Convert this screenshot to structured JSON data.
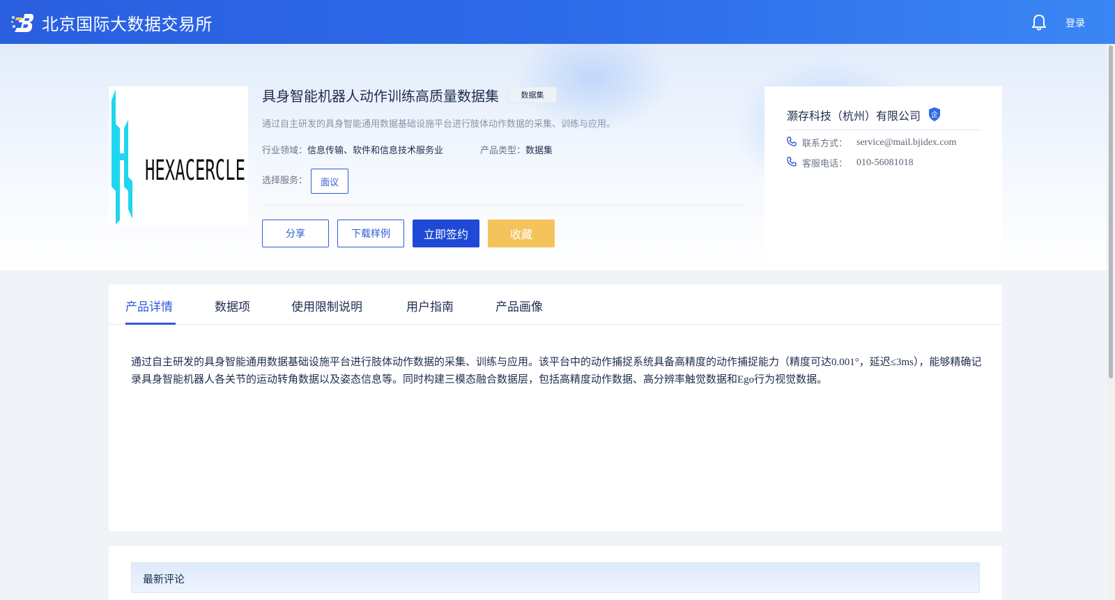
{
  "header": {
    "site_title": "北京国际大数据交易所",
    "login_label": "登录"
  },
  "product": {
    "title": "具身智能机器人动作训练高质量数据集",
    "type_tag": "数据集",
    "subtitle": "通过自主研发的具身智能通用数据基础设施平台进行肢体动作数据的采集、训练与应用。",
    "industry_label": "行业领域：",
    "industry_value": "信息传输、软件和信息技术服务业",
    "product_type_label": "产品类型：",
    "product_type_value": "数据集",
    "service_label": "选择服务：",
    "service_option": "面议",
    "cover_logo_text": "HEXACERCLE"
  },
  "actions": {
    "share": "分享",
    "download_sample": "下载样例",
    "sign_now": "立即签约",
    "favorite": "收藏"
  },
  "seller": {
    "name": "灏存科技（杭州）有限公司",
    "badge": "企",
    "contact_label": "联系方式：",
    "contact_value": "service@mail.bjidex.com",
    "hotline_label": "客服电话：",
    "hotline_value": "010-56081018"
  },
  "tabs": [
    {
      "label": "产品详情"
    },
    {
      "label": "数据项"
    },
    {
      "label": "使用限制说明"
    },
    {
      "label": "用户指南"
    },
    {
      "label": "产品画像"
    }
  ],
  "detail": {
    "description": "通过自主研发的具身智能通用数据基础设施平台进行肢体动作数据的采集、训练与应用。该平台中的动作捕捉系统具备高精度的动作捕捉能力（精度可达0.001°，延迟≤3ms），能够精确记录具身智能机器人各关节的运动转角数据以及姿态信息等。同时构建三模态融合数据层，包括高精度动作数据、高分辨率触觉数据和Ego行为视觉数据。"
  },
  "comments": {
    "title": "最新评论"
  },
  "colors": {
    "brand_blue": "#2e5bd6",
    "header_gradient_start": "#2a5fe0",
    "header_gradient_end": "#3a86f4",
    "favorite_gold": "#f5c35c",
    "logo_cyan": "#1ed6ef"
  },
  "icons": {
    "bell": "bell-icon",
    "phone": "phone-icon",
    "verified": "verified-badge-icon",
    "logo": "site-logo-icon"
  }
}
